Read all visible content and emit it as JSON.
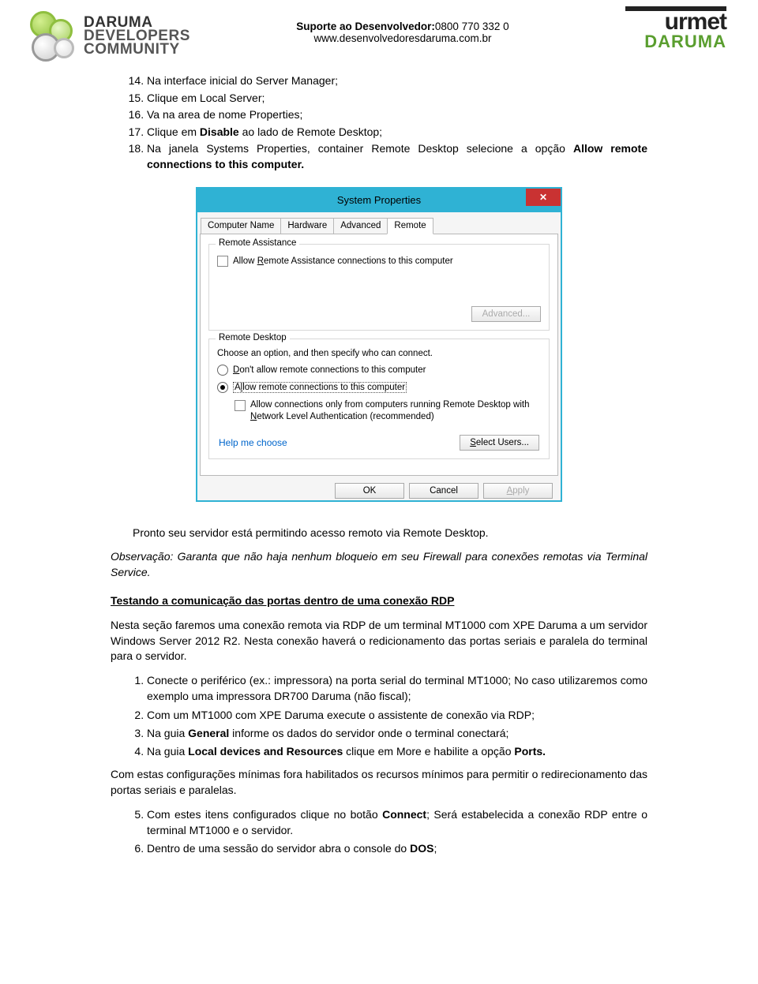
{
  "header": {
    "ddc": {
      "line1": "DARUMA",
      "line2": "DEVELOPERS",
      "line3": "COMMUNITY"
    },
    "center_label": "Suporte ao Desenvolvedor:",
    "center_phone": "0800 770 332 0",
    "center_url": "www.desenvolvedoresdaruma.com.br",
    "urmet": "urmet",
    "daruma": "DARUMA"
  },
  "steps14": {
    "i14": "Na interface inicial do Server Manager;",
    "i15": "Clique em Local Server;",
    "i16": "Va na area de nome Properties;",
    "i17a": "Clique em ",
    "i17b": "Disable",
    "i17c": " ao lado de Remote Desktop;",
    "i18a": "Na janela Systems Properties, container Remote Desktop selecione a opção ",
    "i18b": "Allow remote connections to this computer.",
    "i18c": ""
  },
  "dialog": {
    "title": "System Properties",
    "close": "✕",
    "tabs": {
      "t1": "Computer Name",
      "t2": "Hardware",
      "t3": "Advanced",
      "t4": "Remote"
    },
    "group1_title": "Remote Assistance",
    "ra_check_a": "Allow ",
    "ra_check_u": "R",
    "ra_check_b": "emote Assistance connections to this computer",
    "advanced_btn": "Advanced...",
    "group2_title": "Remote Desktop",
    "rd_instruction": "Choose an option, and then specify who can connect.",
    "rd_opt1_u": "D",
    "rd_opt1": "on't allow remote connections to this computer",
    "rd_opt2_a": "A",
    "rd_opt2_u": "l",
    "rd_opt2_b": "low remote connections to this computer",
    "rd_nla_a": "Allow connections only from computers running Remote Desktop with ",
    "rd_nla_u": "N",
    "rd_nla_b": "etwork Level Authentication (recommended)",
    "help_link": "Help me choose",
    "select_users_u": "S",
    "select_users": "elect Users...",
    "ok": "OK",
    "cancel": "Cancel",
    "apply_u": "A",
    "apply": "pply"
  },
  "after_dialog": {
    "p1": "Pronto seu servidor está permitindo acesso remoto via Remote Desktop.",
    "obs": "Observação: Garanta que não haja nenhum bloqueio em seu Firewall para conexões remotas via Terminal Service."
  },
  "section2": {
    "heading": "Testando a comunicação das portas dentro de uma conexão RDP",
    "p1": "Nesta seção faremos uma conexão remota via RDP de um terminal MT1000 com XPE Daruma a um servidor Windows Server 2012 R2. Nesta conexão haverá o redicionamento das portas seriais e paralela do terminal para o servidor.",
    "li1": "Conecte o periférico (ex.: impressora) na porta serial do terminal MT1000; No caso utilizaremos como exemplo uma impressora DR700 Daruma (não fiscal);",
    "li2": "Com um MT1000 com XPE Daruma execute o assistente de conexão via RDP;",
    "li3a": "Na guia ",
    "li3b": "General",
    "li3c": " informe os dados do servidor onde o terminal conectará;",
    "li4a": "Na guia ",
    "li4b": "Local devices and Resources",
    "li4c": " clique em More e habilite a opção ",
    "li4d": "Ports.",
    "p2": "Com estas configurações mínimas fora habilitados os recursos mínimos para permitir o redirecionamento das portas seriais e paralelas.",
    "li5a": "Com estes itens configurados clique no botão ",
    "li5b": "Connect",
    "li5c": "; Será estabelecida a conexão RDP entre o terminal MT1000 e o servidor.",
    "li6a": "Dentro de uma sessão do servidor abra o console do ",
    "li6b": "DOS",
    "li6c": ";"
  }
}
